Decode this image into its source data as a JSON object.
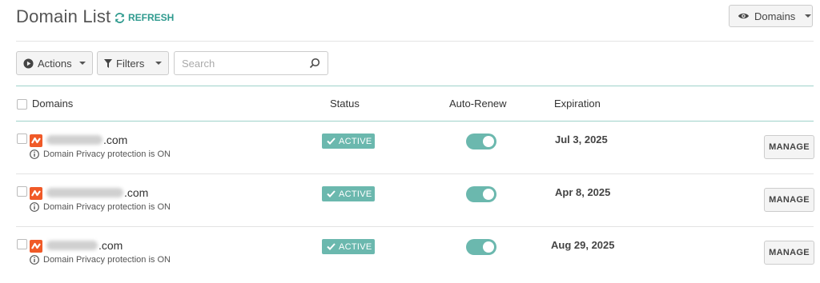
{
  "header": {
    "title": "Domain List",
    "refresh_label": "REFRESH",
    "view_button_label": "Domains"
  },
  "toolbar": {
    "actions_label": "Actions",
    "filters_label": "Filters",
    "search_placeholder": "Search",
    "search_value": ""
  },
  "table": {
    "columns": [
      "Domains",
      "Status",
      "Auto-Renew",
      "Expiration"
    ],
    "rows": [
      {
        "domain_visible": ".com",
        "privacy_note": "Domain Privacy protection is ON",
        "status": "ACTIVE",
        "auto_renew": true,
        "expiration": "Jul 3, 2025",
        "action_label": "MANAGE"
      },
      {
        "domain_visible": ".com",
        "privacy_note": "Domain Privacy protection is ON",
        "status": "ACTIVE",
        "auto_renew": true,
        "expiration": "Apr 8, 2025",
        "action_label": "MANAGE"
      },
      {
        "domain_visible": ".com",
        "privacy_note": "Domain Privacy protection is ON",
        "status": "ACTIVE",
        "auto_renew": true,
        "expiration": "Aug 29, 2025",
        "action_label": "MANAGE"
      }
    ]
  },
  "icons": {
    "refresh": "refresh-icon",
    "eye": "eye-icon",
    "actions": "play-circle-icon",
    "filters": "funnel-icon",
    "search": "search-icon",
    "brand": "registrar-logo",
    "info": "info-icon",
    "check": "check-icon"
  },
  "colors": {
    "accent": "#6bb8ae",
    "refresh_text": "#2e9a8e",
    "brand": "#f05a28"
  }
}
